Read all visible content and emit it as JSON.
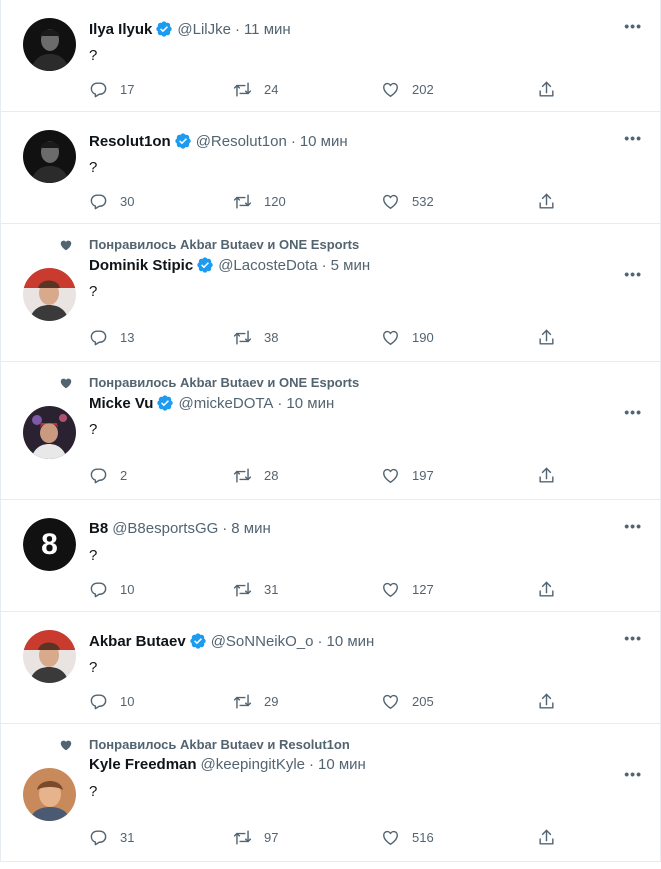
{
  "tweets": [
    {
      "social": "",
      "name": "Ilya Ilyuk",
      "verified": true,
      "handle": "@LilJke",
      "time": "11 мин",
      "text": "?",
      "replies": "17",
      "retweets": "24",
      "likes": "202",
      "avatar": "dark-portrait"
    },
    {
      "social": "",
      "name": "Resolut1on",
      "verified": true,
      "handle": "@Resolut1on",
      "time": "10 мин",
      "text": "?",
      "replies": "30",
      "retweets": "120",
      "likes": "532",
      "avatar": "dark-portrait"
    },
    {
      "social": "Понравилось Akbar Butaev и ONE Esports",
      "name": "Dominik Stipic",
      "verified": true,
      "handle": "@LacosteDota",
      "time": "5 мин",
      "text": "?",
      "replies": "13",
      "retweets": "38",
      "likes": "190",
      "avatar": "red-portrait"
    },
    {
      "social": "Понравилось Akbar Butaev и ONE Esports",
      "name": "Micke Vu",
      "verified": true,
      "handle": "@mickeDOTA",
      "time": "10 мин",
      "text": "?",
      "replies": "2",
      "retweets": "28",
      "likes": "197",
      "avatar": "stage-portrait"
    },
    {
      "social": "",
      "name": "B8",
      "verified": false,
      "handle": "@B8esportsGG",
      "time": "8 мин",
      "text": "?",
      "replies": "10",
      "retweets": "31",
      "likes": "127",
      "avatar": "b8-logo"
    },
    {
      "social": "",
      "name": "Akbar Butaev",
      "verified": true,
      "handle": "@SoNNeikO_o",
      "time": "10 мин",
      "text": "?",
      "replies": "10",
      "retweets": "29",
      "likes": "205",
      "avatar": "red-portrait"
    },
    {
      "social": "Понравилось Akbar Butaev и Resolut1on",
      "name": "Kyle Freedman",
      "verified": false,
      "handle": "@keepingitKyle",
      "time": "10 мин",
      "text": "?",
      "replies": "31",
      "retweets": "97",
      "likes": "516",
      "avatar": "warm-portrait"
    }
  ],
  "more_label": "•••",
  "dot": "·"
}
